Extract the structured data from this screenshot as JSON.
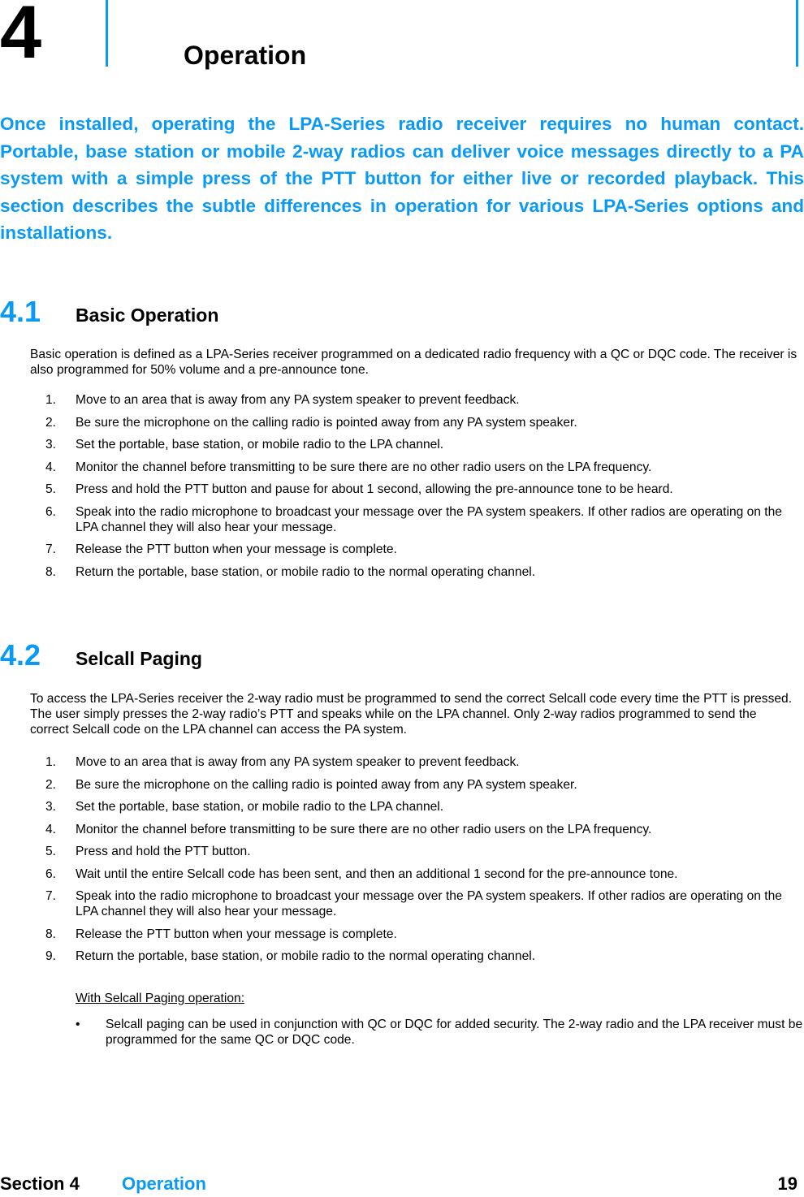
{
  "chapter": {
    "number": "4",
    "title": "Operation",
    "intro": "Once installed, operating the LPA-Series radio receiver requires no human contact. Portable, base station or mobile 2-way radios can deliver voice messages directly to a PA system with a simple press of the PTT button for either live or recorded playback.  This section describes the subtle differences in operation for various LPA-Series options and installations."
  },
  "accent_color": "#0A9AF5",
  "sections": [
    {
      "number": "4.1",
      "title": "Basic Operation",
      "paragraph": "Basic operation is defined as a LPA-Series receiver programmed on a dedicated radio frequency with a QC or DQC code.  The receiver is also programmed for 50% volume and a pre-announce tone.",
      "steps": [
        {
          "num": "1.",
          "text": "Move to an area that is away from any PA system speaker to prevent feedback."
        },
        {
          "num": "2.",
          "text": "Be sure the microphone on the calling radio is pointed away from any PA system speaker."
        },
        {
          "num": "3.",
          "text": "Set the portable, base station, or mobile radio to the LPA channel."
        },
        {
          "num": "4.",
          "text": "Monitor the channel before transmitting to be sure there are no other radio users on the LPA frequency."
        },
        {
          "num": "5.",
          "text": "Press and hold the PTT button and pause for about 1 second, allowing the pre-announce tone to be heard."
        },
        {
          "num": "6.",
          "text": "Speak into the radio microphone to broadcast your message over the PA system speakers.  If other radios are operating on the LPA channel they will also hear your message."
        },
        {
          "num": "7.",
          "text": "Release the PTT button when your message is complete."
        },
        {
          "num": "8.",
          "text": "Return the portable, base station, or mobile radio to the normal operating channel."
        }
      ]
    },
    {
      "number": "4.2",
      "title": "Selcall Paging",
      "paragraph": "To access the LPA-Series receiver the 2-way radio must be programmed to send the correct Selcall code every time the PTT is pressed.  The user simply presses the 2-way radio’s PTT and speaks while on the LPA channel. Only 2-way radios programmed to send the correct Selcall code on the LPA channel can access the PA system.",
      "steps": [
        {
          "num": "1.",
          "text": "Move to an area that is away from any PA system speaker to prevent feedback."
        },
        {
          "num": "2.",
          "text": "Be sure the microphone on the calling radio is pointed away from any PA system speaker."
        },
        {
          "num": "3.",
          "text": "Set the portable, base station, or mobile radio to the LPA channel."
        },
        {
          "num": "4.",
          "text": "Monitor the channel before transmitting to be sure there are no other radio users on the LPA frequency."
        },
        {
          "num": "5.",
          "text": "Press and hold the PTT button."
        },
        {
          "num": "6.",
          "text": "Wait until the entire Selcall code has been sent, and then an additional 1 second for the pre-announce tone."
        },
        {
          "num": "7.",
          "text": "Speak into the radio microphone to broadcast your message over the PA system speakers.  If other radios are operating on the LPA channel they will also hear your message."
        },
        {
          "num": "8.",
          "text": "Release the PTT button when your message is complete."
        },
        {
          "num": "9.",
          "text": "Return the portable, base station, or mobile radio to the normal operating channel."
        }
      ],
      "note_heading": "With Selcall Paging operation:",
      "bullets": [
        {
          "icon": "•",
          "text": "Selcall paging can be used in conjunction with QC or DQC for added security.  The 2-way radio and the LPA receiver must be programmed for the same QC or DQC code."
        }
      ]
    }
  ],
  "footer": {
    "section_label": "Section 4",
    "section_title": "Operation",
    "page_number": "19"
  }
}
